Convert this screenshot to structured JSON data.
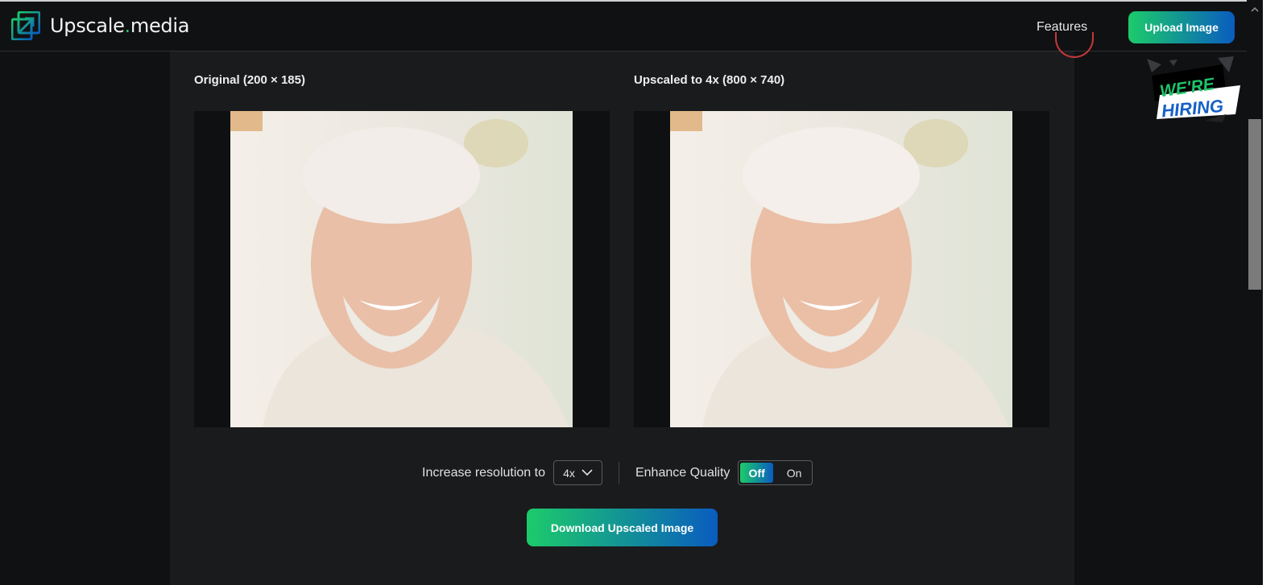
{
  "header": {
    "logo_text_main": "Upscale",
    "logo_text_dot": ".",
    "logo_text_tail": "media",
    "nav_features": "Features",
    "upload_button": "Upload Image"
  },
  "badge": {
    "line1": "WE'RE",
    "line2": "HIRING"
  },
  "original": {
    "label": "Original (200 × 185)"
  },
  "upscaled": {
    "label": "Upscaled to 4x (800 × 740)"
  },
  "controls": {
    "resolution_label": "Increase resolution to",
    "resolution_value": "4x",
    "enhance_label": "Enhance Quality",
    "toggle_off": "Off",
    "toggle_on": "On",
    "toggle_selected": "Off"
  },
  "download_button": "Download Upscaled Image",
  "colors": {
    "accent_green": "#1ccb6a",
    "accent_blue": "#0a5cc0",
    "background": "#101113",
    "panel": "#1a1b1d"
  }
}
